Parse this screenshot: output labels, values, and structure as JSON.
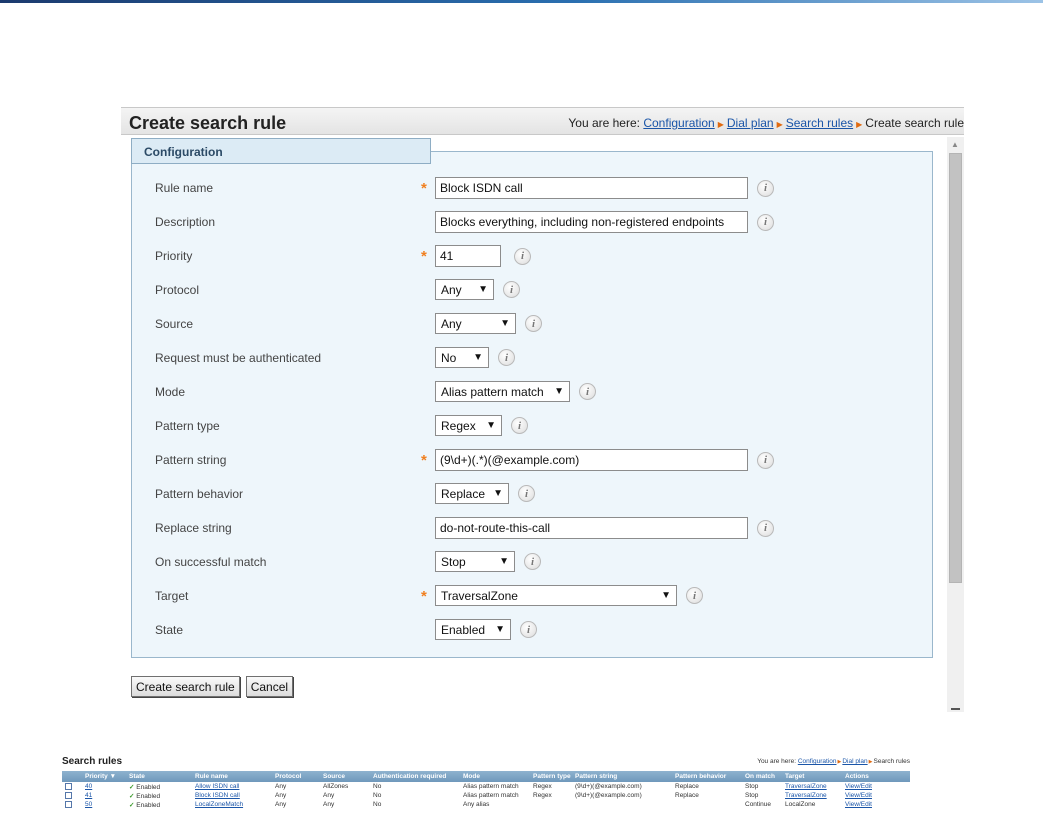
{
  "page": {
    "title": "Create search rule",
    "breadcrumb": {
      "prefix": "You are here:",
      "links": [
        "Configuration",
        "Dial plan",
        "Search rules"
      ],
      "current": "Create search rule"
    }
  },
  "form": {
    "section_title": "Configuration",
    "rule_name": {
      "label": "Rule name",
      "value": "Block ISDN call"
    },
    "description": {
      "label": "Description",
      "value": "Blocks everything, including non-registered endpoints"
    },
    "priority": {
      "label": "Priority",
      "value": "41"
    },
    "protocol": {
      "label": "Protocol",
      "value": "Any"
    },
    "source": {
      "label": "Source",
      "value": "Any"
    },
    "auth": {
      "label": "Request must be authenticated",
      "value": "No"
    },
    "mode": {
      "label": "Mode",
      "value": "Alias pattern match"
    },
    "pattern_type": {
      "label": "Pattern type",
      "value": "Regex"
    },
    "pattern_string": {
      "label": "Pattern string",
      "value": "(9\\d+)(.*)(@example.com)"
    },
    "pattern_behavior": {
      "label": "Pattern behavior",
      "value": "Replace"
    },
    "replace_string": {
      "label": "Replace string",
      "value": "do-not-route-this-call"
    },
    "on_match": {
      "label": "On successful match",
      "value": "Stop"
    },
    "target": {
      "label": "Target",
      "value": "TraversalZone"
    },
    "state": {
      "label": "State",
      "value": "Enabled"
    },
    "info_glyph": "i"
  },
  "buttons": {
    "create": "Create search rule",
    "cancel": "Cancel"
  },
  "search_rules_table": {
    "title": "Search rules",
    "breadcrumb": {
      "prefix": "You are here:",
      "links": [
        "Configuration",
        "Dial plan"
      ],
      "current": "Search rules"
    },
    "columns": [
      "Priority",
      "State",
      "Rule name",
      "Protocol",
      "Source",
      "Authentication required",
      "Mode",
      "Pattern type",
      "Pattern string",
      "Pattern behavior",
      "On match",
      "Target",
      "Actions"
    ],
    "rows": [
      {
        "priority": "40",
        "state": "Enabled",
        "rule_name": "Allow ISDN call",
        "protocol": "Any",
        "source": "AllZones",
        "auth": "No",
        "mode": "Alias pattern match",
        "pattern_type": "Regex",
        "pattern_string": "(9\\d+)(@example.com)",
        "pattern_behavior": "Replace",
        "on_match": "Stop",
        "target": "TraversalZone",
        "action": "View/Edit"
      },
      {
        "priority": "41",
        "state": "Enabled",
        "rule_name": "Block ISDN call",
        "protocol": "Any",
        "source": "Any",
        "auth": "No",
        "mode": "Alias pattern match",
        "pattern_type": "Regex",
        "pattern_string": "(9\\d+)(@example.com)",
        "pattern_behavior": "Replace",
        "on_match": "Stop",
        "target": "TraversalZone",
        "action": "View/Edit"
      },
      {
        "priority": "50",
        "state": "Enabled",
        "rule_name": "LocalZoneMatch",
        "protocol": "Any",
        "source": "Any",
        "auth": "No",
        "mode": "Any alias",
        "pattern_type": "",
        "pattern_string": "",
        "pattern_behavior": "",
        "on_match": "Continue",
        "target": "LocalZone",
        "action": "View/Edit"
      }
    ],
    "check_glyph": "✓",
    "sort_glyph": "▼"
  },
  "colors": {
    "accent_orange": "#f08020",
    "link_blue": "#1a55a8",
    "panel_bg": "#eef6fb",
    "table_header": "#7fa6c6"
  }
}
